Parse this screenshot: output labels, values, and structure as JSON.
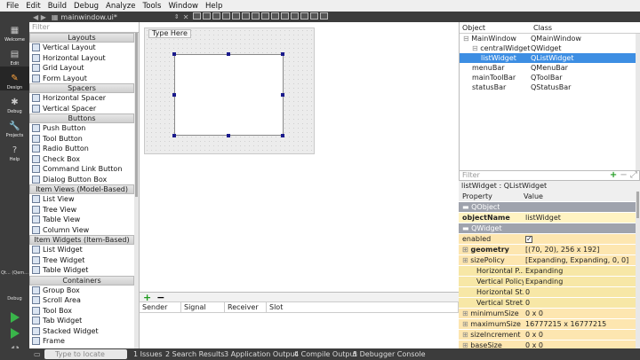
{
  "menu": [
    "File",
    "Edit",
    "Build",
    "Debug",
    "Analyze",
    "Tools",
    "Window",
    "Help"
  ],
  "modes": [
    {
      "label": "Welcome",
      "icon": "grid-icon"
    },
    {
      "label": "Edit",
      "icon": "document-icon"
    },
    {
      "label": "Design",
      "icon": "pencil-icon"
    },
    {
      "label": "Debug",
      "icon": "bug-icon"
    },
    {
      "label": "Projects",
      "icon": "wrench-icon"
    },
    {
      "label": "Help",
      "icon": "help-icon"
    }
  ],
  "kit_label": "Qt... (Qem...",
  "kit_debug": "Debug",
  "file_tab": "mainwindow.ui*",
  "widgetbox": {
    "filter_placeholder": "Filter",
    "sections": [
      {
        "title": "Layouts",
        "items": [
          "Vertical Layout",
          "Horizontal Layout",
          "Grid Layout",
          "Form Layout"
        ]
      },
      {
        "title": "Spacers",
        "items": [
          "Horizontal Spacer",
          "Vertical Spacer"
        ]
      },
      {
        "title": "Buttons",
        "items": [
          "Push Button",
          "Tool Button",
          "Radio Button",
          "Check Box",
          "Command Link Button",
          "Dialog Button Box"
        ]
      },
      {
        "title": "Item Views (Model-Based)",
        "items": [
          "List View",
          "Tree View",
          "Table View",
          "Column View"
        ]
      },
      {
        "title": "Item Widgets (Item-Based)",
        "items": [
          "List Widget",
          "Tree Widget",
          "Table Widget"
        ]
      },
      {
        "title": "Containers",
        "items": [
          "Group Box",
          "Scroll Area",
          "Tool Box",
          "Tab Widget",
          "Stacked Widget",
          "Frame"
        ]
      }
    ]
  },
  "form": {
    "menu_placeholder": "Type Here"
  },
  "signal_slot": {
    "add": "+",
    "remove": "−",
    "columns": [
      "Sender",
      "Signal",
      "Receiver",
      "Slot"
    ]
  },
  "object_inspector": {
    "headers": [
      "Object",
      "Class"
    ],
    "rows": [
      {
        "object": "MainWindow",
        "class": "QMainWindow",
        "indent": 0
      },
      {
        "object": "centralWidget",
        "class": "QWidget",
        "indent": 1
      },
      {
        "object": "listWidget",
        "class": "QListWidget",
        "indent": 2,
        "selected": true
      },
      {
        "object": "menuBar",
        "class": "QMenuBar",
        "indent": 1
      },
      {
        "object": "mainToolBar",
        "class": "QToolBar",
        "indent": 1
      },
      {
        "object": "statusBar",
        "class": "QStatusBar",
        "indent": 1
      }
    ]
  },
  "property_editor": {
    "filter_placeholder": "Filter",
    "object_label": "listWidget : QListWidget",
    "headers": [
      "Property",
      "Value"
    ],
    "rows": [
      {
        "name": "QObject",
        "value": "",
        "type": "sec"
      },
      {
        "name": "objectName",
        "value": "listWidget",
        "type": "y1",
        "bold": true
      },
      {
        "name": "QWidget",
        "value": "",
        "type": "sec"
      },
      {
        "name": "enabled",
        "value": "✓",
        "type": "y2"
      },
      {
        "name": "geometry",
        "value": "[(70, 20), 256 x 192]",
        "type": "y2",
        "bold": true
      },
      {
        "name": "sizePolicy",
        "value": "[Expanding, Expanding, 0, 0]",
        "type": "y2"
      },
      {
        "name": "Horizontal P...",
        "value": "Expanding",
        "type": "y3",
        "sub": true
      },
      {
        "name": "Vertical Policy",
        "value": "Expanding",
        "type": "y3",
        "sub": true
      },
      {
        "name": "Horizontal St...",
        "value": "0",
        "type": "y3",
        "sub": true
      },
      {
        "name": "Vertical Stret...",
        "value": "0",
        "type": "y3",
        "sub": true
      },
      {
        "name": "minimumSize",
        "value": "0 x 0",
        "type": "y2"
      },
      {
        "name": "maximumSize",
        "value": "16777215 x 16777215",
        "type": "y2"
      },
      {
        "name": "sizeIncrement",
        "value": "0 x 0",
        "type": "y2"
      },
      {
        "name": "baseSize",
        "value": "0 x 0",
        "type": "y2"
      }
    ]
  },
  "statusbar": {
    "locate_placeholder": "Type to locate (Ctrl...",
    "tabs": [
      "1 Issues",
      "2 Search Results",
      "3 Application Output",
      "4 Compile Output",
      "5 Debugger Console"
    ]
  }
}
